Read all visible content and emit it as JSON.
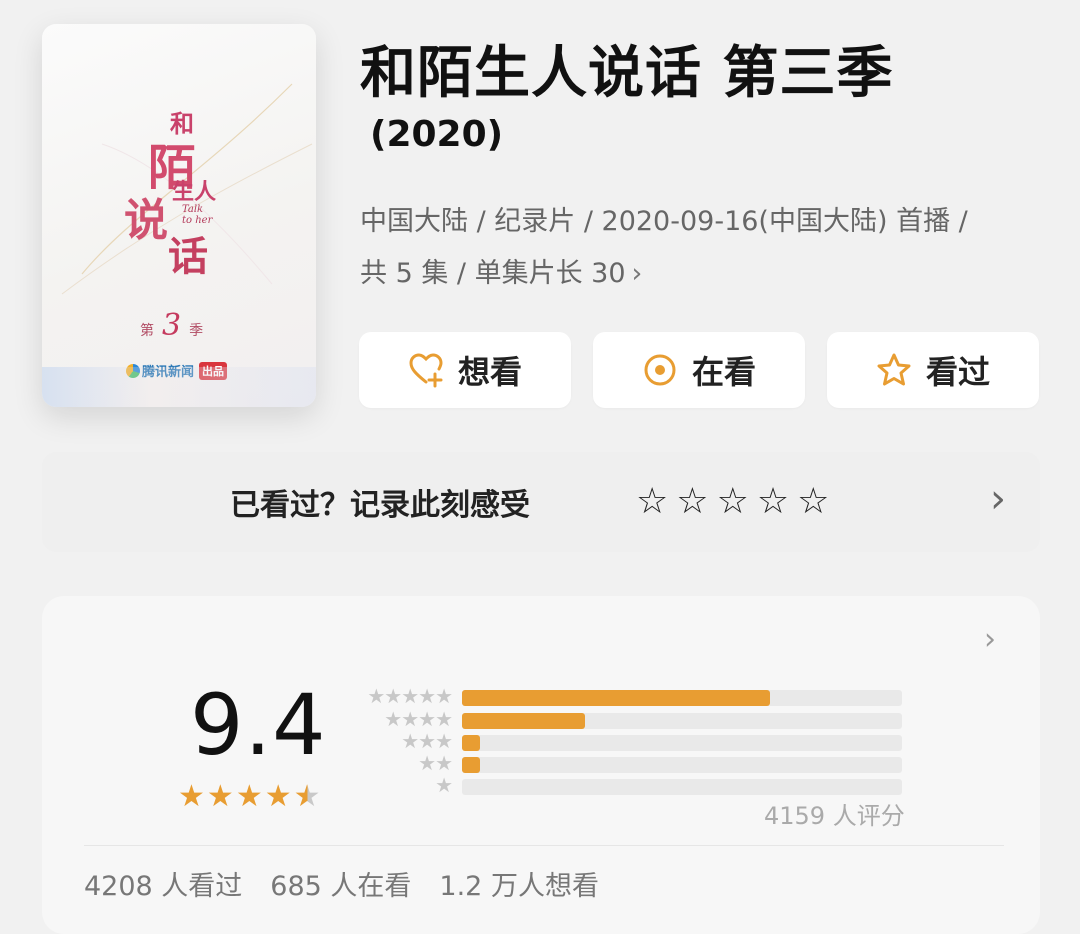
{
  "poster": {
    "calligraphy": [
      "和",
      "陌",
      "生人",
      "说",
      "话"
    ],
    "subtitle_en": [
      "Talk",
      "to her"
    ],
    "season_prefix": "第",
    "season_number": "3",
    "season_suffix": "季",
    "brand": "腾讯新闻",
    "brand_tag": "出品"
  },
  "title": "和陌生人说话 第三季",
  "year": "(2020)",
  "meta": {
    "line1": "中国大陆 / 纪录片 / 2020-09-16(中国大陆) 首播 /",
    "line2": "共 5 集 / 单集片长 30"
  },
  "buttons": {
    "want": "想看",
    "watching": "在看",
    "watched": "看过"
  },
  "record": {
    "text": "已看过？记录此刻感受",
    "star_count": 5
  },
  "rating": {
    "score": "9.4",
    "stars_value": 4.5,
    "distribution": [
      {
        "stars": 5,
        "fraction": 0.7
      },
      {
        "stars": 4,
        "fraction": 0.28
      },
      {
        "stars": 3,
        "fraction": 0.04
      },
      {
        "stars": 2,
        "fraction": 0.04
      },
      {
        "stars": 1,
        "fraction": 0.0
      }
    ],
    "count_text": "4159 人评分"
  },
  "stats": {
    "watched": "4208 人看过",
    "watching": "685 人在看",
    "want": "1.2 万人想看"
  },
  "colors": {
    "accent": "#e89d32",
    "background": "#f1f1f1",
    "card": "#f7f7f7"
  }
}
